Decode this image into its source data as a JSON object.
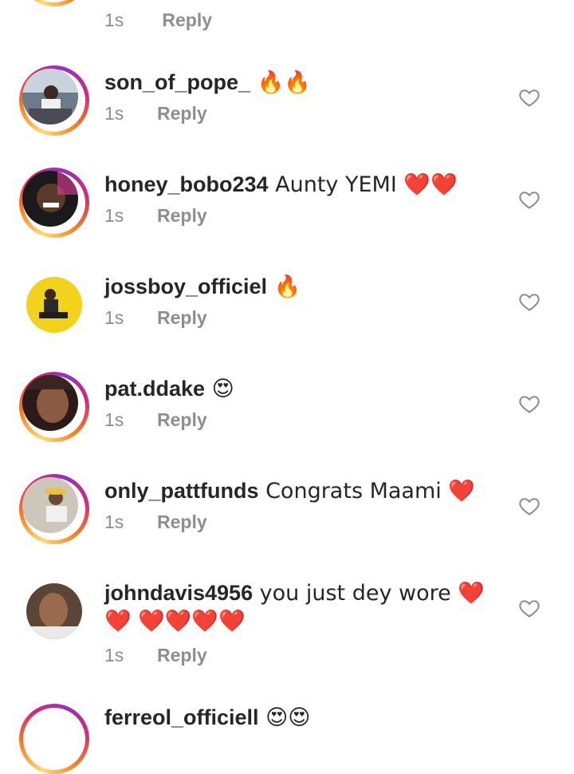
{
  "top_partial": {
    "time": "1s",
    "reply": "Reply"
  },
  "comments": [
    {
      "username": "son_of_pope_",
      "text": " 🔥🔥",
      "time": "1s",
      "reply": "Reply"
    },
    {
      "username": "honey_bobo234",
      "text": " Aunty YEMI ❤️❤️",
      "time": "1s",
      "reply": "Reply"
    },
    {
      "username": "jossboy_officiel",
      "text": " 🔥",
      "time": "1s",
      "reply": "Reply"
    },
    {
      "username": "pat.ddake",
      "text": " 😍",
      "time": "1s",
      "reply": "Reply"
    },
    {
      "username": "only_pattfunds",
      "text": " Congrats Maami ❤️",
      "time": "1s",
      "reply": "Reply"
    },
    {
      "username": "johndavis4956",
      "text": " you just dey wore ❤️❤️ ❤️❤️❤️❤️",
      "time": "1s",
      "reply": "Reply"
    },
    {
      "username": "ferreol_officiell",
      "text": " 😍😍"
    }
  ],
  "icons": {
    "like": "heart-outline-icon"
  },
  "colors": {
    "meta": "#8e8e8e",
    "text": "#262626",
    "heart_outline": "#8e8e8e"
  }
}
